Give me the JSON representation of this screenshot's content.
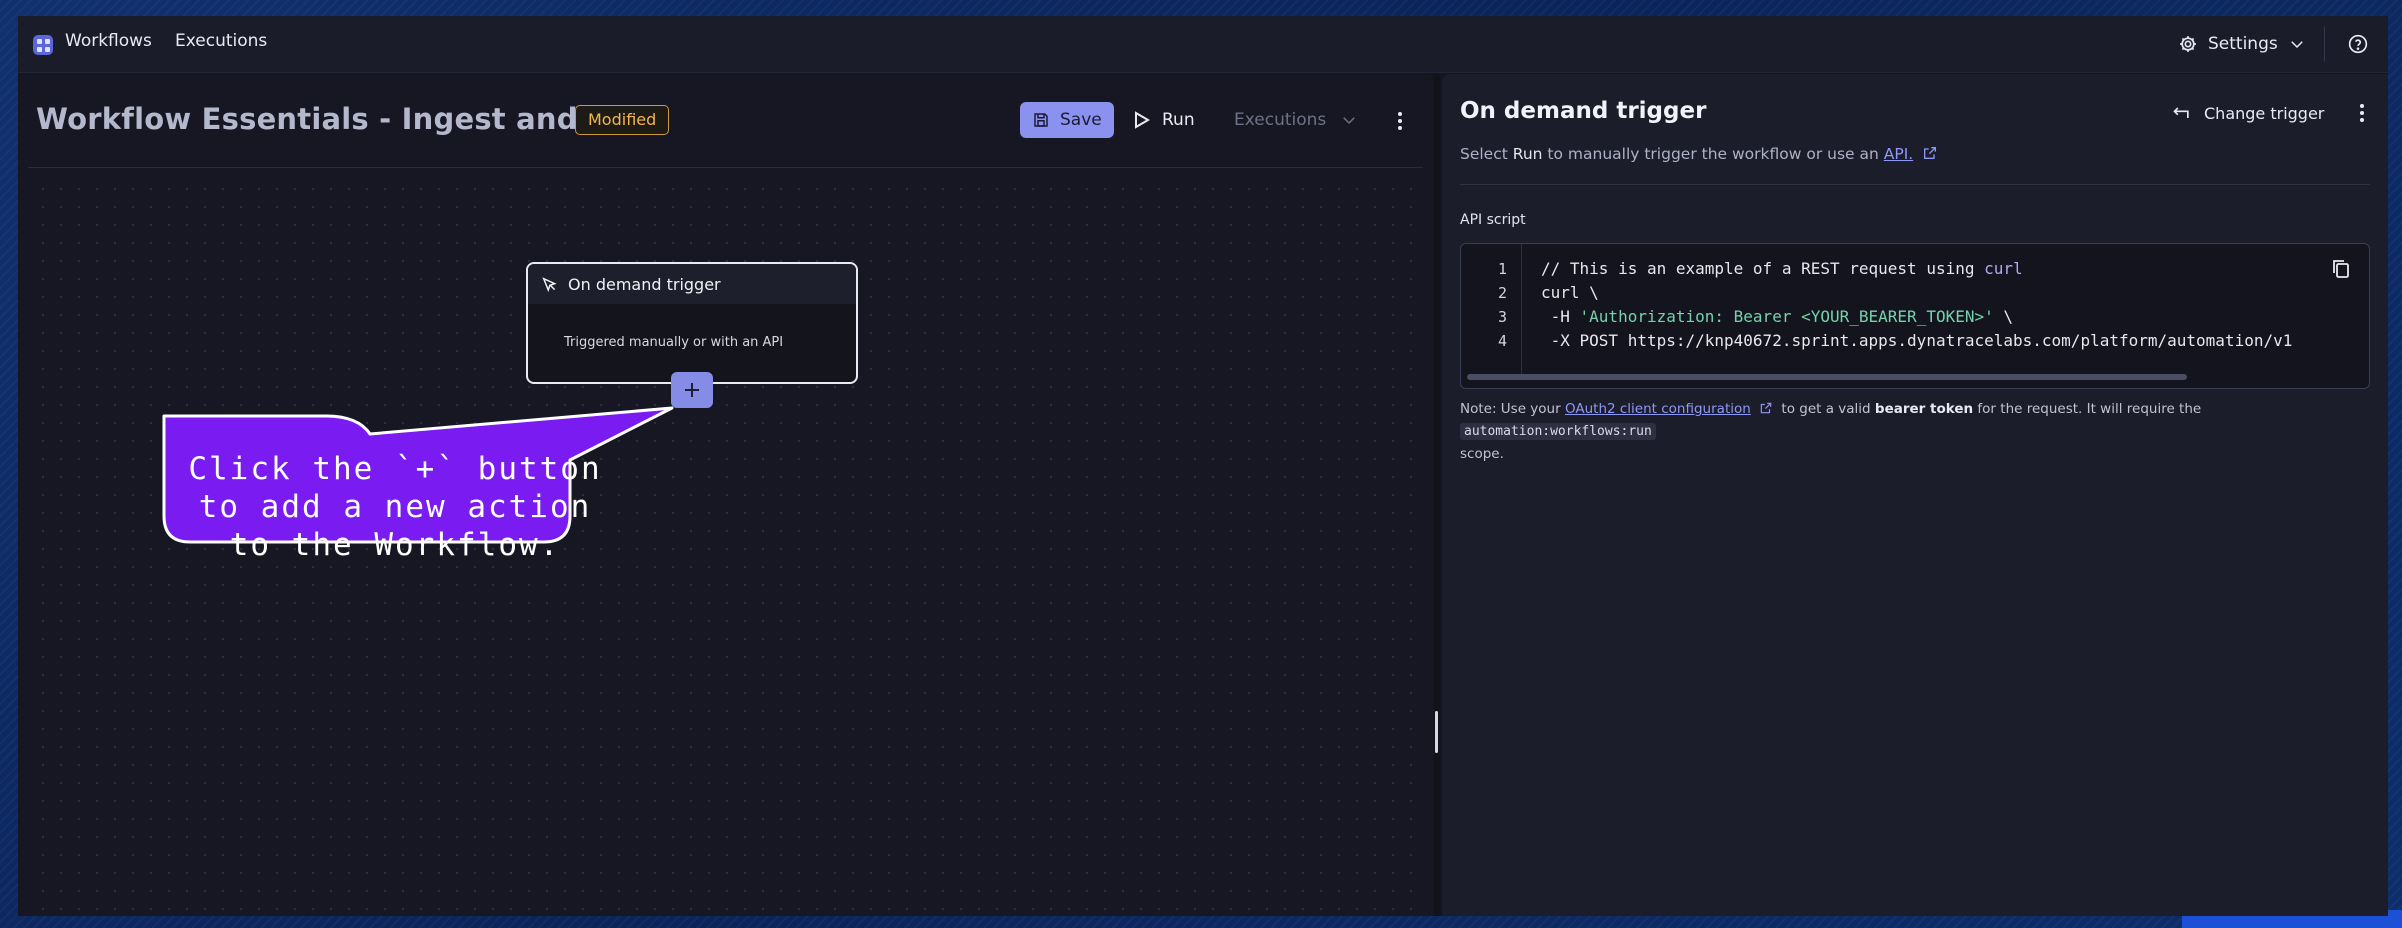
{
  "topbar": {
    "nav": [
      "Workflows",
      "Executions"
    ],
    "settings_label": "Settings"
  },
  "workflow": {
    "title": "Workflow Essentials - Ingest and Alert",
    "status_badge": "Modified",
    "save_label": "Save",
    "run_label": "Run",
    "executions_label": "Executions"
  },
  "canvas": {
    "node": {
      "title": "On demand trigger",
      "description": "Triggered manually or with an API"
    },
    "callout": {
      "lines": [
        "Click the `+` button",
        "to add a new action",
        "to the Workflow."
      ],
      "color": "#7a1bf2"
    }
  },
  "panel": {
    "title": "On demand trigger",
    "change_trigger_label": "Change trigger",
    "subtitle_prefix": "Select ",
    "subtitle_bold": "Run",
    "subtitle_mid": " to manually trigger the workflow or use an ",
    "subtitle_link": "API.",
    "api_script_label": "API script",
    "code": {
      "line_numbers": [
        "1",
        "2",
        "3",
        "4"
      ],
      "line1_text": "// This is an example of a REST request using ",
      "line1_kw": "curl",
      "line2": "curl \\",
      "line3_pre": " -H ",
      "line3_str": "'Authorization: Bearer <YOUR_BEARER_TOKEN>'",
      "line3_post": " \\",
      "line4": " -X POST https://knp40672.sprint.apps.dynatracelabs.com/platform/automation/v1"
    },
    "note": {
      "prefix": "Note: Use your ",
      "link": "OAuth2 client configuration",
      "mid": " to get a valid ",
      "bold": "bearer token",
      "mid2": " for the request. It will require the ",
      "scope": "automation:workflows:run",
      "suffix": "scope."
    }
  },
  "colors": {
    "accent": "#8b91ef",
    "modified": "#f2b64f",
    "callout_fill": "#7a1bf2",
    "code_string": "#74d3ab"
  }
}
